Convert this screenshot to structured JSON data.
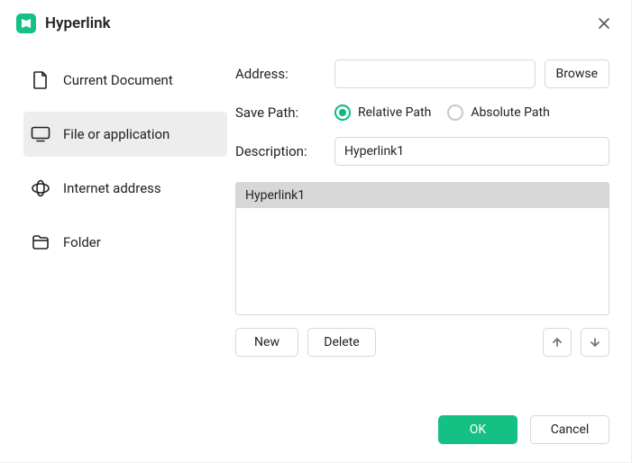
{
  "header": {
    "title": "Hyperlink"
  },
  "sidebar": {
    "items": [
      {
        "label": "Current Document"
      },
      {
        "label": "File or application"
      },
      {
        "label": "Internet address"
      },
      {
        "label": "Folder"
      }
    ],
    "active_index": 1
  },
  "form": {
    "address_label": "Address:",
    "address_value": "",
    "browse_label": "Browse",
    "savepath_label": "Save Path:",
    "relative_label": "Relative Path",
    "absolute_label": "Absolute Path",
    "savepath_selected": "relative",
    "description_label": "Description:",
    "description_value": "Hyperlink1"
  },
  "list": {
    "items": [
      "Hyperlink1"
    ],
    "selected_index": 0,
    "new_label": "New",
    "delete_label": "Delete"
  },
  "footer": {
    "ok_label": "OK",
    "cancel_label": "Cancel"
  }
}
